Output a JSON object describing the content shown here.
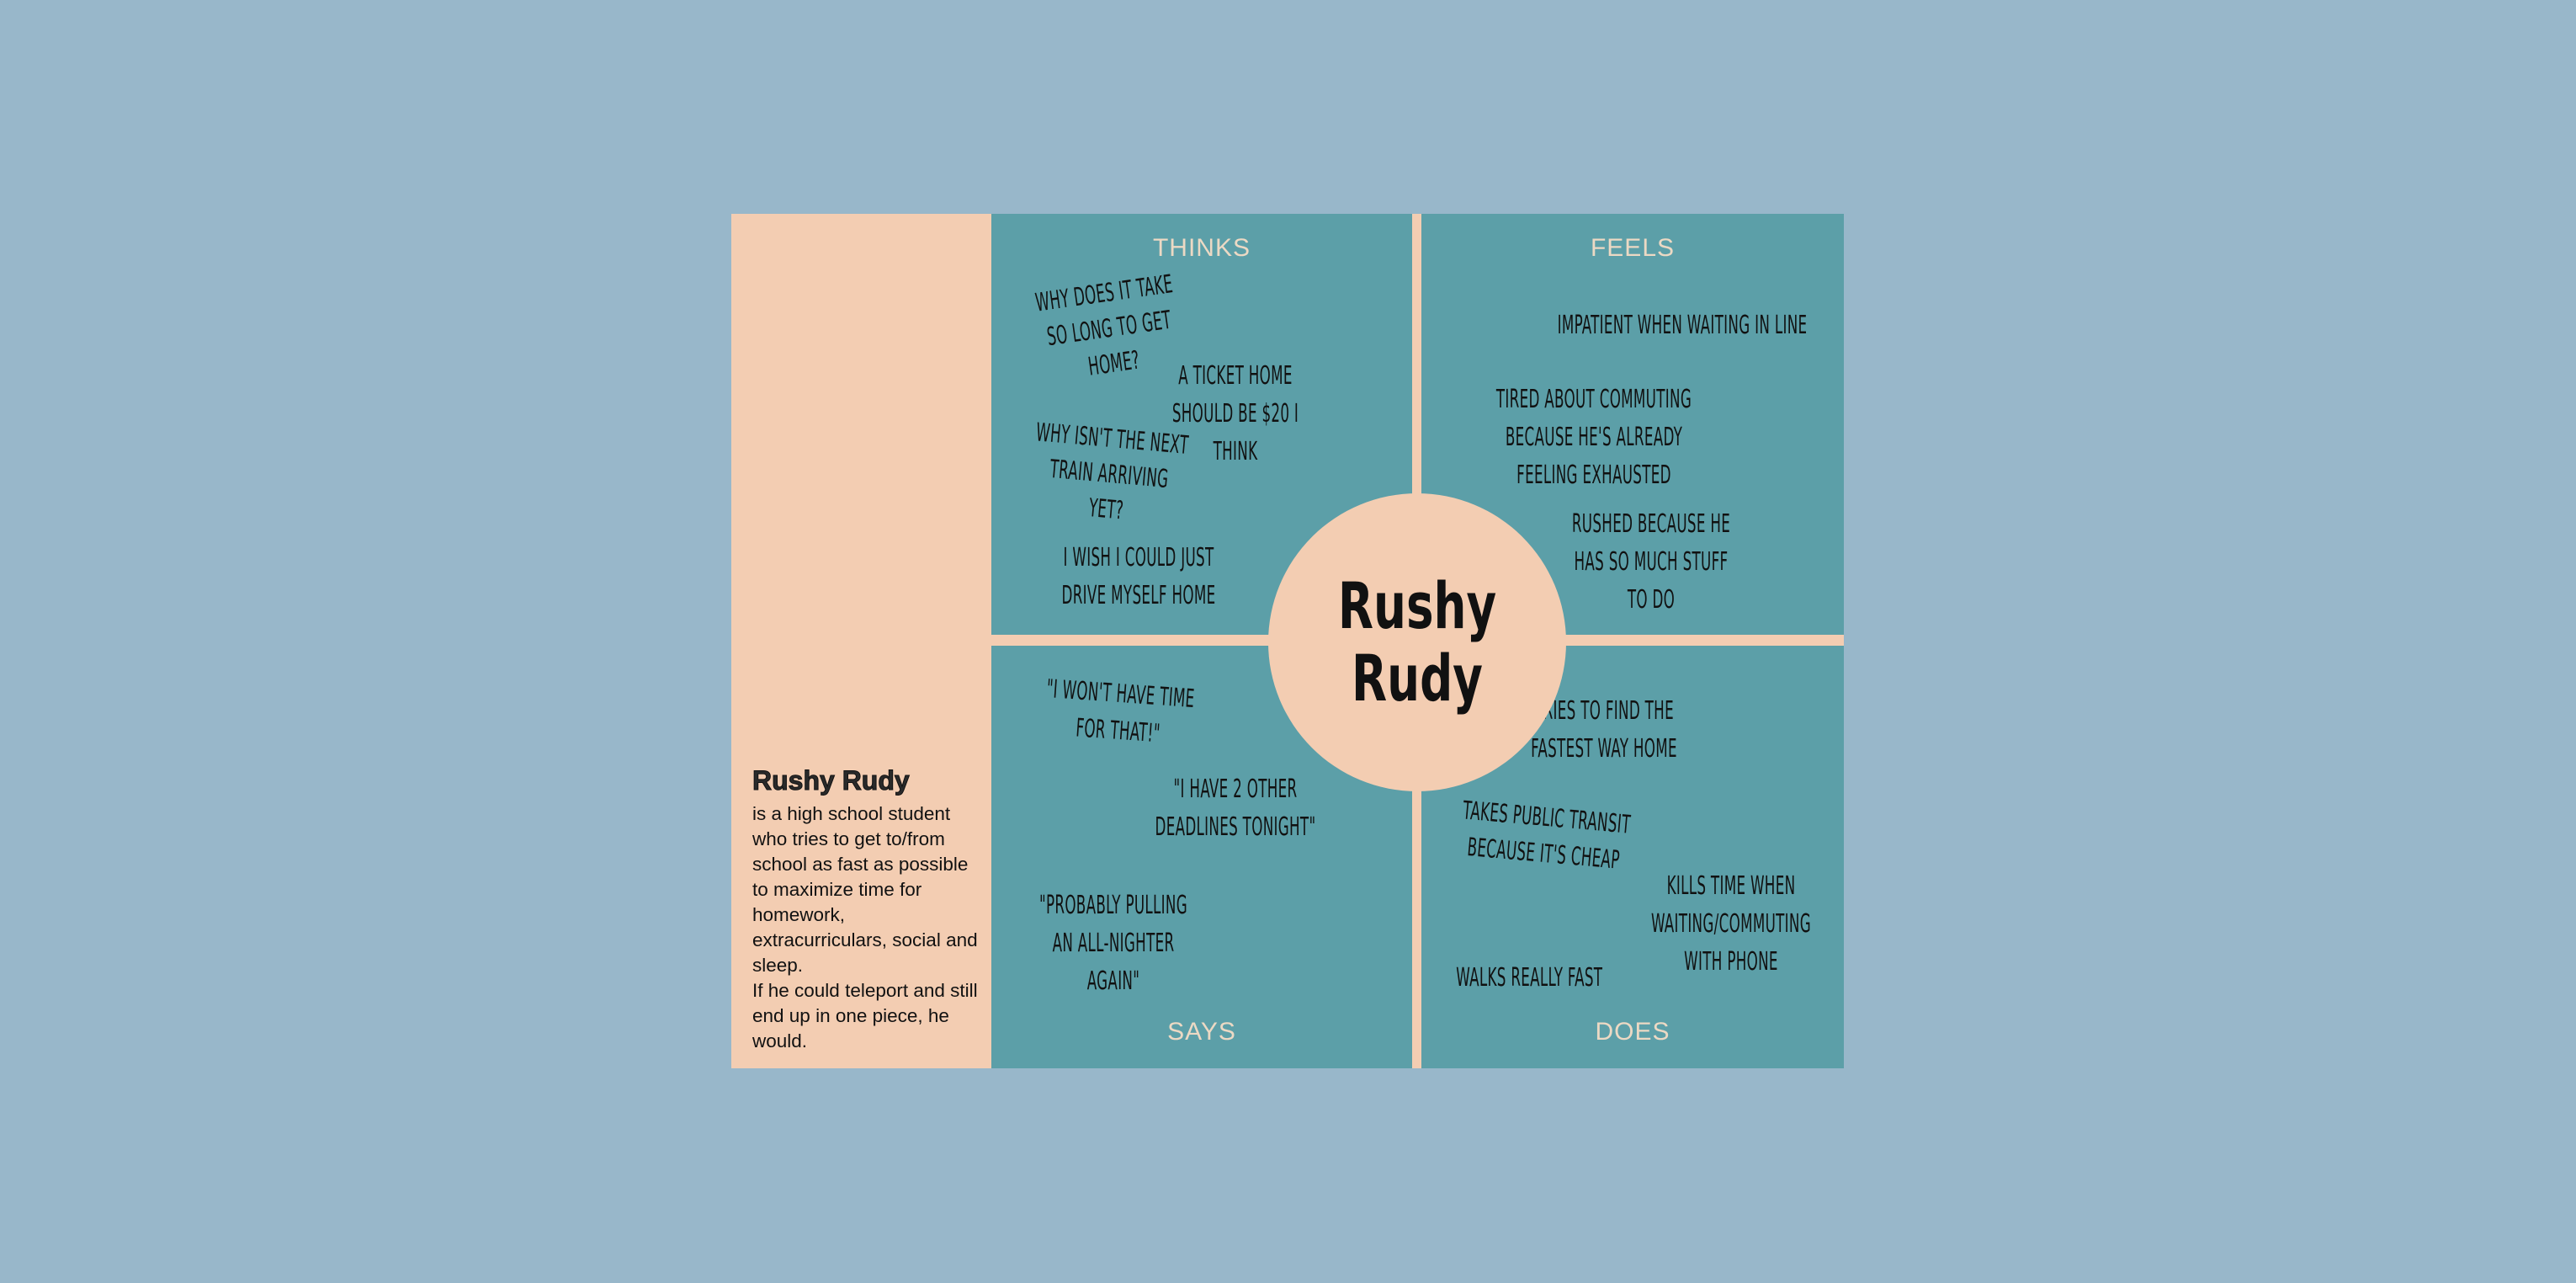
{
  "persona": {
    "name": "Rushy Rudy",
    "description": "is a high school student who tries to get to/from school as fast as possible to maximize time for homework, extracurriculars, social and sleep.\nIf he could teleport and still end up in one piece, he would."
  },
  "center": {
    "title": "Rushy Rudy"
  },
  "quadrants": {
    "thinks": {
      "label": "THINKS",
      "notes": [
        "Why does it take so long to get home?",
        "A ticket home should be $20 I think",
        "Why isn't the next train arriving yet?",
        "I wish I could just drive myself home"
      ]
    },
    "feels": {
      "label": "FEELS",
      "notes": [
        "Impatient when waiting in line",
        "Tired about commuting because he's already feeling exhausted",
        "Rushed because he has so much stuff to do"
      ]
    },
    "says": {
      "label": "SAYS",
      "notes": [
        "\"I won't have time for that!\"",
        "\"I have 2 other deadlines tonight\"",
        "\"Probably pulling an all-nighter again\""
      ]
    },
    "does": {
      "label": "DOES",
      "notes": [
        "Tries to find the fastest way home",
        "Takes public transit because it's cheap",
        "Kills time when waiting/commuting with phone",
        "Walks really fast"
      ]
    }
  },
  "colors": {
    "background": "#98b7ca",
    "quadrant": "#5c9fa8",
    "accent": "#f3cdb2"
  }
}
